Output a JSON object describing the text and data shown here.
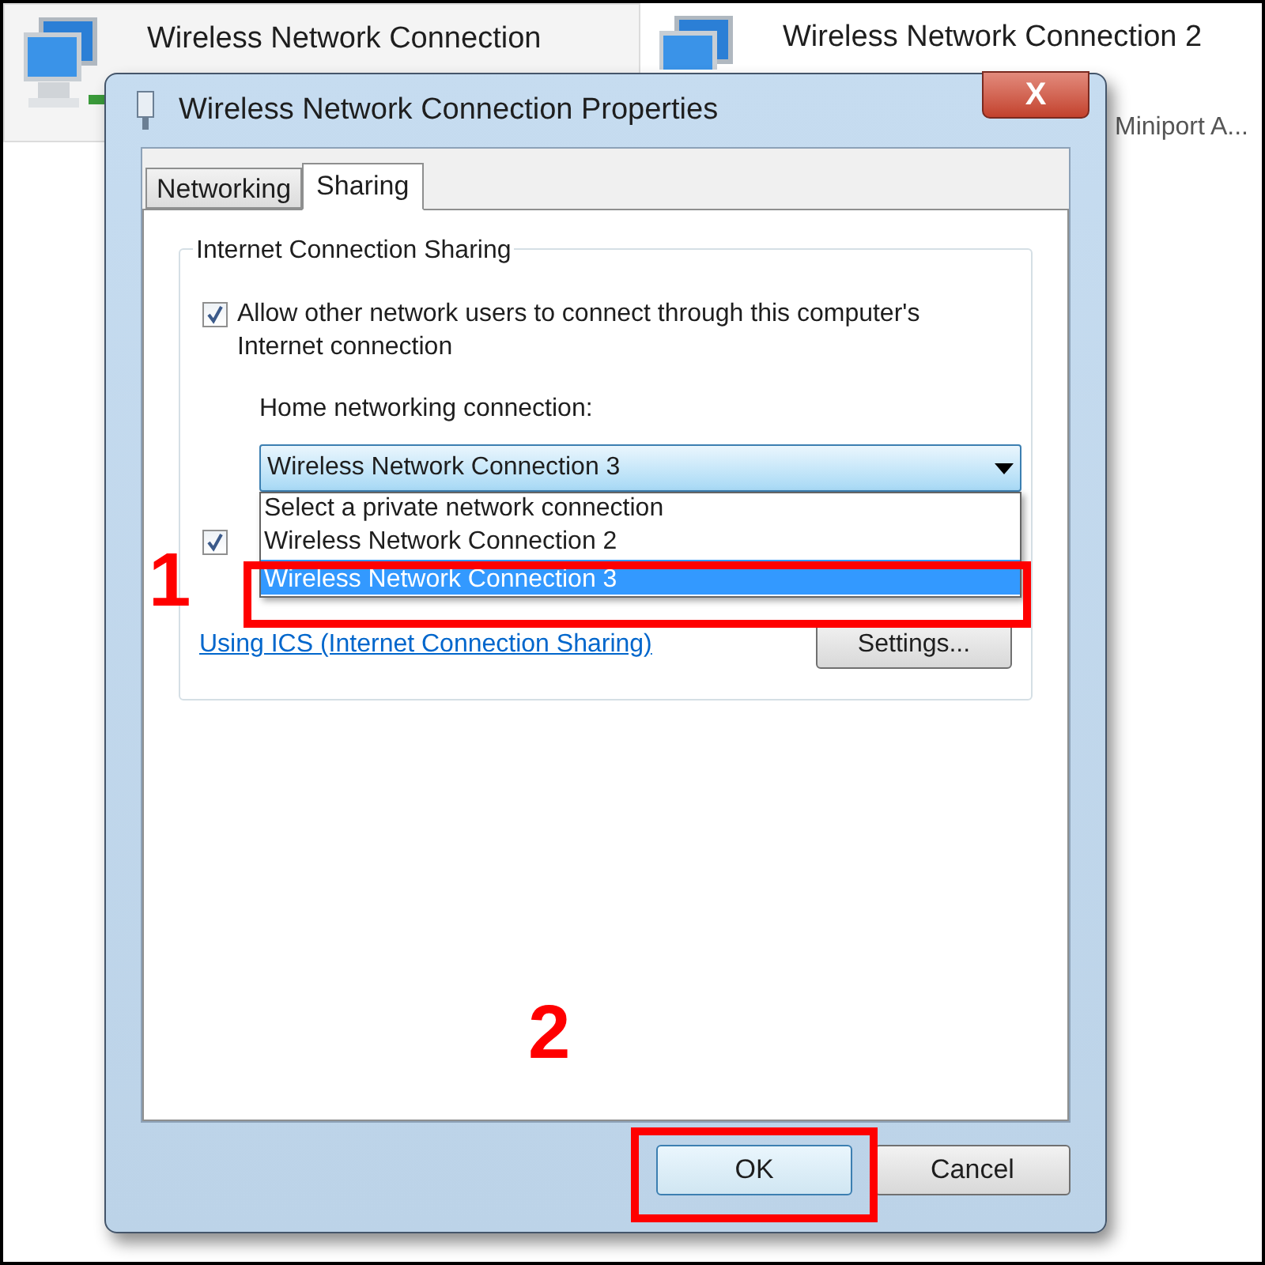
{
  "background_items": [
    {
      "title": "Wireless Network Connection"
    },
    {
      "title": "Wireless Network Connection 2",
      "detail": "Miniport A..."
    }
  ],
  "window": {
    "title": "Wireless Network Connection Properties",
    "close": "X"
  },
  "tabs": [
    {
      "label": "Networking",
      "selected": false
    },
    {
      "label": "Sharing",
      "selected": true
    }
  ],
  "group": {
    "title": "Internet Connection Sharing"
  },
  "allow_option": {
    "label": "Allow other network users to connect through this computer's Internet connection",
    "checked": true
  },
  "home_connection": {
    "label": "Home networking connection:",
    "value": "Wireless Network Connection 3",
    "expanded": true,
    "options": [
      {
        "label": "Select a private network connection",
        "selected": false
      },
      {
        "label": "Wireless Network Connection 2",
        "selected": false
      },
      {
        "label": "Wireless Network Connection 3",
        "selected": true
      }
    ]
  },
  "control_option": {
    "checked": true
  },
  "link": "Using ICS (Internet Connection Sharing)",
  "settings_button": "Settings...",
  "buttons": [
    "OK",
    "Cancel"
  ],
  "annotations": [
    {
      "label": "1"
    },
    {
      "label": "2"
    }
  ]
}
